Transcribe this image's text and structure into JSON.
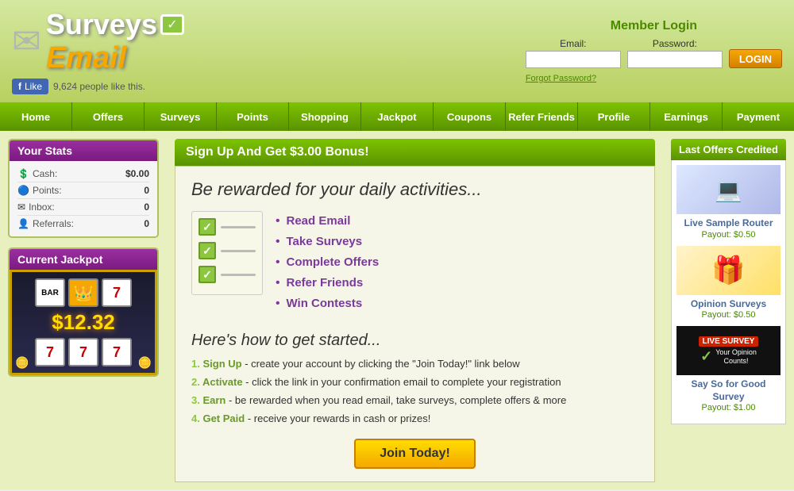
{
  "header": {
    "logo_surveys": "Surveys",
    "logo_email": "Email",
    "fb_like_label": "Like",
    "fb_like_count": "9,624 people like this.",
    "login_title": "Member Login",
    "email_label": "Email:",
    "password_label": "Password:",
    "login_button": "LOGIN",
    "forgot_password": "Forgot Password?"
  },
  "nav": {
    "items": [
      "Home",
      "Offers",
      "Surveys",
      "Points",
      "Shopping",
      "Jackpot",
      "Coupons",
      "Refer Friends",
      "Profile",
      "Earnings",
      "Payment"
    ]
  },
  "sidebar": {
    "stats_title": "Your Stats",
    "stats": [
      {
        "label": "Cash:",
        "value": "$0.00"
      },
      {
        "label": "Points:",
        "value": "0"
      },
      {
        "label": "Inbox:",
        "value": "0"
      },
      {
        "label": "Referrals:",
        "value": "0"
      }
    ],
    "jackpot_title": "Current Jackpot",
    "jackpot_amount": "$12.32"
  },
  "main": {
    "signup_banner": "Sign Up And Get $3.00 Bonus!",
    "reward_headline": "Be rewarded for your daily activities...",
    "activities": [
      "Read Email",
      "Take Surveys",
      "Complete Offers",
      "Refer Friends",
      "Win Contests"
    ],
    "how_to_start": "Here's how to get started...",
    "steps": [
      {
        "num": "1.",
        "bold": "Sign Up",
        "text": " - create your account by clicking the \"Join Today!\" link below"
      },
      {
        "num": "2.",
        "bold": "Activate",
        "text": " - click the link in your confirmation email to complete your registration"
      },
      {
        "num": "3.",
        "bold": "Earn",
        "text": " - be rewarded when you read email, take surveys, complete offers & more"
      },
      {
        "num": "4.",
        "bold": "Get Paid",
        "text": " - receive your rewards in cash or prizes!"
      }
    ],
    "join_button": "Join Today!"
  },
  "right_sidebar": {
    "last_offers_title": "Last Offers Credited",
    "offers": [
      {
        "title": "Live Sample Router",
        "payout": "Payout: $0.50",
        "type": "router"
      },
      {
        "title": "Opinion Surveys",
        "payout": "Payout: $0.50",
        "type": "gift"
      },
      {
        "title": "Say So for Good Survey",
        "payout": "Payout: $1.00",
        "type": "survey"
      }
    ]
  }
}
